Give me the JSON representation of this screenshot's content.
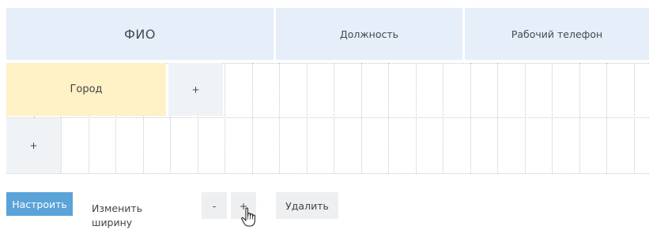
{
  "table": {
    "headers": [
      "ФИО",
      "Должность",
      "Рабочий телефон"
    ],
    "rows": [
      {
        "cells": [
          {
            "text": "Город",
            "type": "field"
          },
          {
            "text": "+",
            "type": "add"
          }
        ]
      },
      {
        "cells": [
          {
            "text": "+",
            "type": "add"
          }
        ]
      }
    ]
  },
  "toolbar": {
    "configure_label": "Настроить",
    "change_width_label": "Изменить ширину",
    "decrease_label": "-",
    "increase_label": "+",
    "delete_label": "Удалить"
  },
  "colors": {
    "header_bg": "#e6eef9",
    "field_bg": "#fdf1c5",
    "add_bg": "#f0f3f6",
    "primary_button": "#5aa3d9",
    "gray_button": "#eeeff1"
  },
  "icons": {
    "cursor": "hand-pointer-icon"
  }
}
